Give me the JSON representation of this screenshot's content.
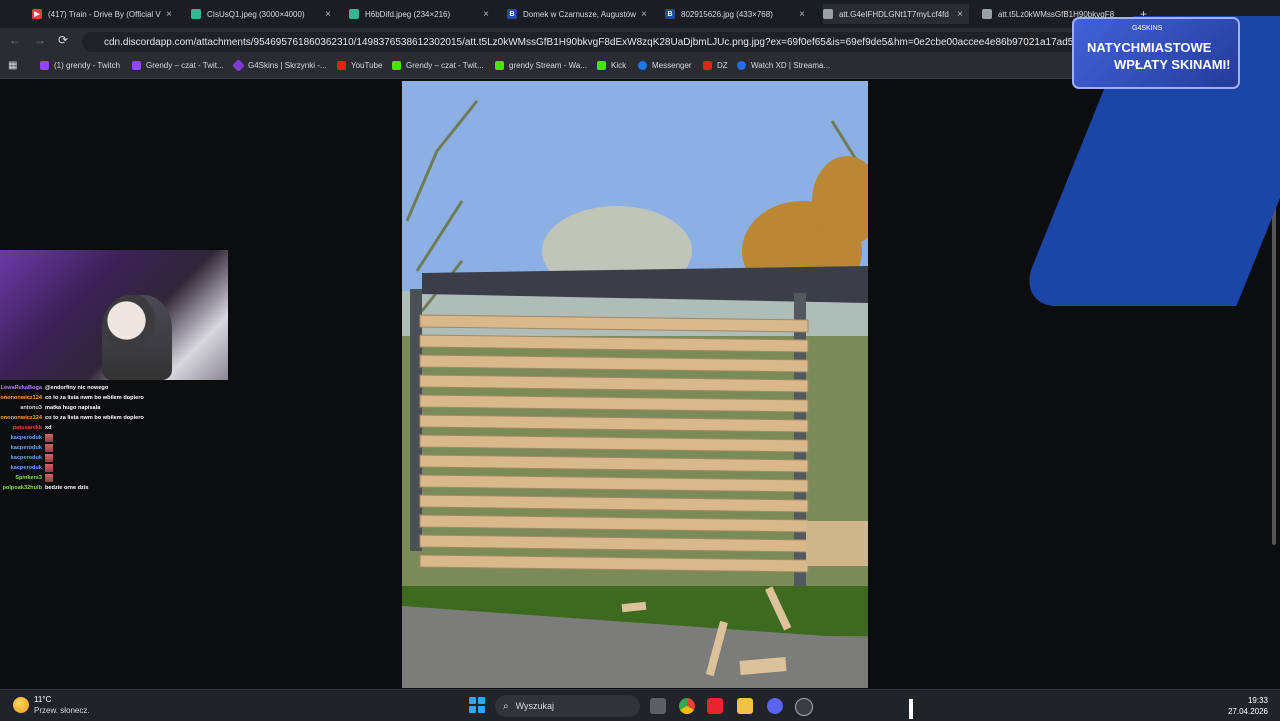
{
  "tabs": [
    {
      "label": "(417) Train - Drive By (Official V",
      "color": "#e0403d"
    },
    {
      "label": "CIsUsQ1.jpeg (3000×4000)",
      "color": "#3ab58f"
    },
    {
      "label": "H6bDifd.jpeg (234×216)",
      "color": "#3ab58f"
    },
    {
      "label": "Domek w Czarnusze, Augustów",
      "color": "#234aa6"
    },
    {
      "label": "802915626.jpg (433×768)",
      "color": "#234aa6"
    },
    {
      "label": "att.G4eIFHDLGNt1T7myLcf4fd",
      "color": "#9aa0a8"
    },
    {
      "label": "att.t5Lz0kWMssGfB1H90bkvgF8",
      "color": "#9aa0a8"
    }
  ],
  "tab_close": "×",
  "tab_new": "+",
  "address": {
    "url": "cdn.discordapp.com/attachments/954695761860362310/1498376538612302015/att.t5Lz0kWMssGfB1H90bkvgF8dExW8zqK28UaDjbmLJUc.png.jpg?ex=69f0ef65&is=69ef9de5&hm=0e2cbe00accee4e86b97021a17ad52d4aba9b83a24da..."
  },
  "nav": {
    "back": "←",
    "forward": "→",
    "reload": "⟳"
  },
  "bookmarks": [
    {
      "label": "(1) grendy - Twitch",
      "color": "#9146ff"
    },
    {
      "label": "Grendy – czat - Twit...",
      "color": "#9146ff"
    },
    {
      "label": "G4Skins | Skrzynki -...",
      "color": "#7d3bd1"
    },
    {
      "label": "YouTube",
      "color": "#e62117"
    },
    {
      "label": "Grendy – czat - Twit...",
      "color": "#4ee000"
    },
    {
      "label": "grendy Stream - Wa...",
      "color": "#4ee000"
    },
    {
      "label": "Kick",
      "color": "#4ee000"
    },
    {
      "label": "Messenger",
      "color": "#1877f2"
    },
    {
      "label": "DZ",
      "color": "#e62117"
    },
    {
      "label": "Watch XD | Streama...",
      "color": "#1f6feb"
    }
  ],
  "promo": {
    "brand": "G4SKINS",
    "line1": "NATYCHMIASTOWE",
    "line2": "WPŁATY SKINAMI!"
  },
  "chat": [
    {
      "user": "LewaRekaBoga",
      "text": "@endorfiny nic nowego",
      "color": "#b57cff"
    },
    {
      "user": "onononwicz124",
      "text": "co to za lista nwm bo wbilem dopiero",
      "color": "#ff9e3d"
    },
    {
      "user": "antonu3",
      "text": "matka hugo napisala",
      "color": "#d7d7d7"
    },
    {
      "user": "onononwicz124",
      "text": "co to za lista nwm bo wbilem dopiero",
      "color": "#ff9e3d"
    },
    {
      "user": "patusanikk",
      "text": "xd",
      "color": "#ff3b3b"
    },
    {
      "user": "kacperoduk",
      "text": "",
      "color": "#6aa8ff"
    },
    {
      "user": "kacperoduk",
      "text": "",
      "color": "#6aa8ff"
    },
    {
      "user": "kacperoduk",
      "text": "",
      "color": "#6aa8ff"
    },
    {
      "user": "kacperoduk",
      "text": "",
      "color": "#6aa8ff"
    },
    {
      "user": "Spinkers3",
      "text": "",
      "color": "#8bdc4f"
    },
    {
      "user": "polpoak32hulb",
      "text": "bedzie orne dzis",
      "color": "#8bdc4f"
    }
  ],
  "taskbar": {
    "temperature": "11°C",
    "weather": "Przew. słonecz.",
    "search_placeholder": "Wyszukaj",
    "time": "19:33",
    "date": "27.04.2026"
  }
}
